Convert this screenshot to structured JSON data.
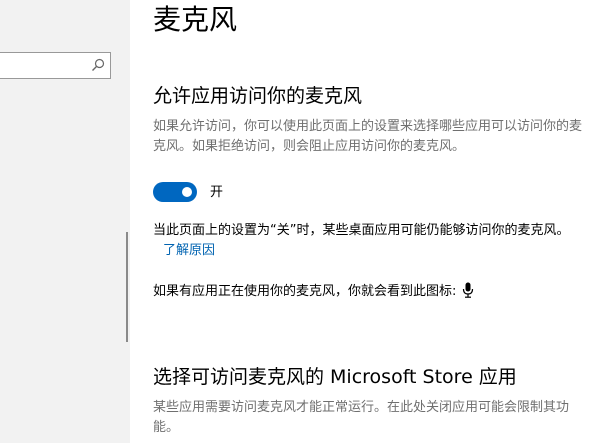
{
  "sidebar": {
    "search": {
      "placeholder": "",
      "icon": "search-icon"
    }
  },
  "page": {
    "title": "麦克风"
  },
  "allow_access": {
    "title": "允许应用访问你的麦克风",
    "description": "如果允许访问，你可以使用此页面上的设置来选择哪些应用可以访问你的麦克风。如果拒绝访问，则会阻止应用访问你的麦克风。",
    "toggle_state": "on",
    "toggle_label": "开",
    "toggle_color": "#0067c0"
  },
  "desktop_note": {
    "text": "当此页面上的设置为“关”时，某些桌面应用可能仍能够访问你的麦克风。",
    "link_text": "了解原因",
    "link_color": "#0063b1"
  },
  "icon_note": {
    "text": "如果有应用正在使用你的麦克风，你就会看到此图标:",
    "icon": "microphone-icon"
  },
  "store_apps": {
    "title": "选择可访问麦克风的 Microsoft Store 应用",
    "description": "某些应用需要访问麦克风才能正常运行。在此处关闭应用可能会限制其功能。"
  }
}
